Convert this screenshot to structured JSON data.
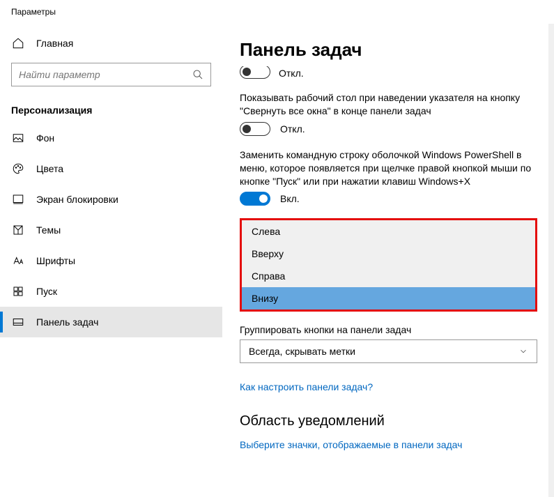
{
  "window": {
    "title": "Параметры"
  },
  "sidebar": {
    "home": "Главная",
    "search_placeholder": "Найти параметр",
    "section": "Персонализация",
    "items": [
      {
        "label": "Фон"
      },
      {
        "label": "Цвета"
      },
      {
        "label": "Экран блокировки"
      },
      {
        "label": "Темы"
      },
      {
        "label": "Шрифты"
      },
      {
        "label": "Пуск"
      },
      {
        "label": "Панель задач"
      }
    ]
  },
  "main": {
    "title": "Панель задач",
    "clipped_off_label": "Откл.",
    "setting_peek": {
      "text": "Показывать рабочий стол при наведении указателя на кнопку \"Свернуть все окна\" в конце панели задач",
      "state_label": "Откл."
    },
    "setting_powershell": {
      "text": "Заменить командную строку оболочкой Windows PowerShell в меню, которое появляется при щелчке правой кнопкой мыши по кнопке \"Пуск\" или при нажатии клавиш Windows+X",
      "state_label": "Вкл."
    },
    "position_dropdown": {
      "options": [
        "Слева",
        "Вверху",
        "Справа",
        "Внизу"
      ],
      "selected_index": 3
    },
    "group_buttons": {
      "label": "Группировать кнопки на панели задач",
      "value": "Всегда, скрывать метки"
    },
    "link_configure": "Как настроить панели задач?",
    "notification_area": {
      "heading": "Область уведомлений",
      "link": "Выберите значки, отображаемые в панели задач"
    }
  },
  "colors": {
    "accent": "#0078d4",
    "highlight_border": "#e40b0a",
    "selection": "#65a7df",
    "link": "#0067c0"
  }
}
